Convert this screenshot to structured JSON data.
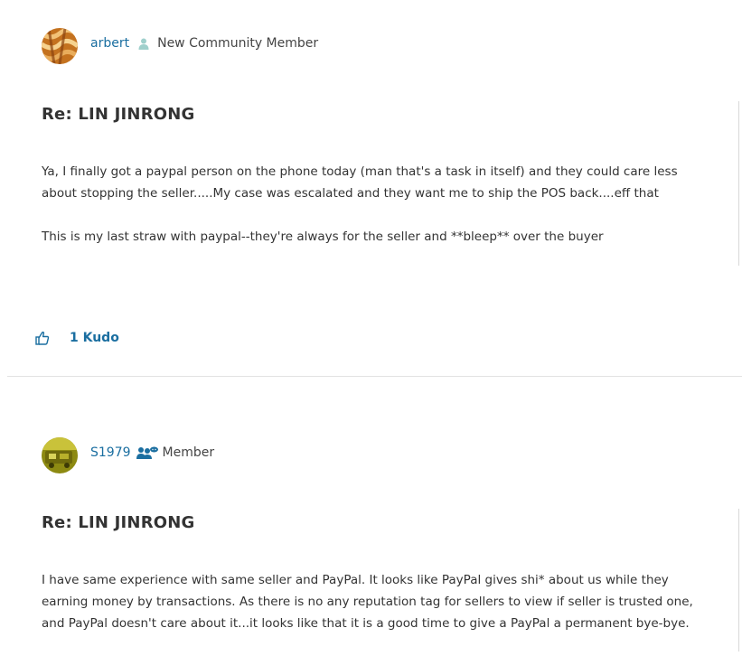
{
  "posts": [
    {
      "author": "arbert",
      "rank": "New Community Member",
      "subject": "Re: LIN JINRONG",
      "paragraphs": [
        "Ya, I finally got a paypal person on the phone today (man that's a task in itself) and they could care less about stopping the seller.....My case was escalated and they want me to ship the POS back....eff that",
        "This is my last straw with paypal--they're always for the seller and **bleep** over the buyer"
      ],
      "kudos_label": "1 Kudo"
    },
    {
      "author": "S1979",
      "rank": "Member",
      "subject": "Re: LIN JINRONG",
      "paragraphs": [
        "I have same experience with same seller and PayPal. It looks like PayPal gives shi* about us while they earning money by transactions. As there is no any reputation tag for sellers to view if seller is trusted one, and PayPal doesn't care about it...it looks like that it is a good time to give a PayPal a permanent bye-bye."
      ]
    }
  ],
  "colors": {
    "link": "#1a6ea0",
    "rank_icon": "#9fd0cc",
    "member_icon": "#1a6ea0",
    "divider": "#e2e2e2"
  },
  "icons": {
    "new_member_rank": "person-icon",
    "member_rank": "member-group-icon",
    "kudo": "thumbs-up-icon"
  }
}
